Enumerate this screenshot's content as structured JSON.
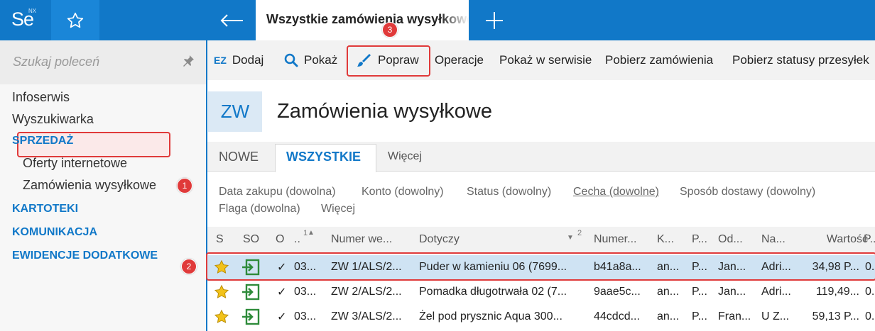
{
  "app": {
    "logo": "Se",
    "logo_super": "NX"
  },
  "topbar": {
    "active_tab": "Wszystkie zamówienia wysyłkowe"
  },
  "sidebar": {
    "search_placeholder": "Szukaj poleceń",
    "items": [
      {
        "label": "Infoserwis",
        "type": "item"
      },
      {
        "label": "Wyszukiwarka",
        "type": "item"
      },
      {
        "label": "SPRZEDAŻ",
        "type": "section"
      },
      {
        "label": "Oferty internetowe",
        "type": "subitem"
      },
      {
        "label": "Zamówienia wysyłkowe",
        "type": "subitem-selected"
      },
      {
        "label": "KARTOTEKI",
        "type": "section"
      },
      {
        "label": "KOMUNIKACJA",
        "type": "section"
      },
      {
        "label": "EWIDENCJE DODATKOWE",
        "type": "section"
      }
    ]
  },
  "toolbar": {
    "ez_label": "EZ",
    "dodaj": "Dodaj",
    "pokaz": "Pokaż",
    "popraw": "Popraw",
    "operacje": "Operacje",
    "pokaz_w_serwisie": "Pokaż w serwisie",
    "pobierz_zamowienia": "Pobierz zamówienia",
    "pobierz_statusy": "Pobierz statusy przesyłek"
  },
  "header": {
    "badge": "ZW",
    "title": "Zamówienia wysyłkowe"
  },
  "tabs": [
    {
      "label": "NOWE"
    },
    {
      "label": "WSZYSTKIE"
    },
    {
      "label": "Więcej"
    }
  ],
  "filters": {
    "data_zakupu": "Data zakupu (dowolna)",
    "konto": "Konto (dowolny)",
    "status": "Status (dowolny)",
    "cecha": "Cecha (dowolne)",
    "sposob_dostawy": "Sposób dostawy (dowolny)",
    "flaga": "Flaga (dowolna)",
    "wiecej": "Więcej"
  },
  "grid": {
    "columns": [
      "S",
      "SO",
      "O",
      "..",
      "Numer we...",
      "Dotyczy",
      "Numer...",
      "K...",
      "P...",
      "Od...",
      "Na...",
      "Wartość",
      "P..."
    ],
    "sort_markers": {
      "col3": "1",
      "col5": "2"
    },
    "rows": [
      {
        "num": "03...",
        "numer": "ZW 1/ALS/2...",
        "dotyczy": "Puder w kamieniu 06 (7699...",
        "numer2": "b41a8a...",
        "k": "an...",
        "p": "P...",
        "od": "Jan...",
        "na": "Adri...",
        "wartosc": "34,98 P...",
        "p2": "0."
      },
      {
        "num": "03...",
        "numer": "ZW 2/ALS/2...",
        "dotyczy": "Pomadka długotrwała 02 (7...",
        "numer2": "9aae5c...",
        "k": "an...",
        "p": "P...",
        "od": "Jan...",
        "na": "Adri...",
        "wartosc": "119,49...",
        "p2": "0."
      },
      {
        "num": "03...",
        "numer": "ZW 3/ALS/2...",
        "dotyczy": "Żel pod prysznic Aqua 300...",
        "numer2": "44cdcd...",
        "k": "an...",
        "p": "P...",
        "od": "Fran...",
        "na": "U Z...",
        "wartosc": "59,13 P...",
        "p2": "0."
      }
    ]
  },
  "callouts": [
    "1",
    "2",
    "3"
  ],
  "colors": {
    "accent": "#1178c8",
    "highlight": "#e03a3a",
    "selected_row": "#cfe3f3",
    "star": "#f2c21a",
    "import_icon": "#2e8b3a"
  }
}
